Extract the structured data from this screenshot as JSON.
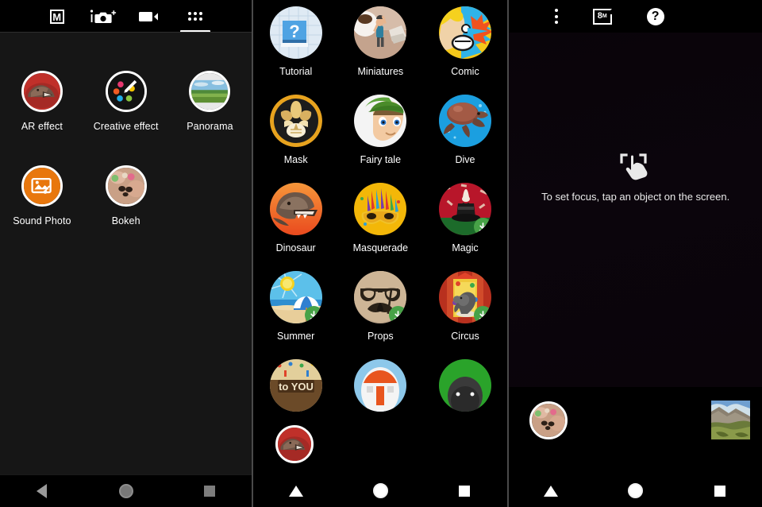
{
  "left_panel": {
    "name": "camera-mode-picker",
    "topbar": {
      "modes": [
        {
          "id": "manual-mode",
          "icon": "m-badge-icon",
          "label": "M",
          "active": false
        },
        {
          "id": "superior-auto-mode",
          "icon": "camera-plus-icon",
          "label": "i+",
          "active": false
        },
        {
          "id": "video-mode",
          "icon": "video-camera-icon",
          "label": "Video",
          "active": false
        },
        {
          "id": "apps-mode",
          "icon": "app-grid-icon",
          "label": "Apps",
          "active": true
        }
      ]
    },
    "effects": [
      {
        "label": "AR effect",
        "icon": "ar-effect-icon",
        "bg": "#b5302a"
      },
      {
        "label": "Creative effect",
        "icon": "creative-effect-icon",
        "bg": "#121212"
      },
      {
        "label": "Panorama",
        "icon": "panorama-icon",
        "bg": "#86b06a"
      },
      {
        "label": "Sound Photo",
        "icon": "sound-photo-icon",
        "bg": "#e8770d"
      },
      {
        "label": "Bokeh",
        "icon": "bokeh-icon",
        "bg": "#c79a84"
      }
    ]
  },
  "middle_panel": {
    "name": "ar-effect-gallery",
    "effects": [
      {
        "label": "Tutorial",
        "icon": "tutorial-book-icon",
        "bg": "#d9e7f2",
        "downloadable": false
      },
      {
        "label": "Miniatures",
        "icon": "miniatures-icon",
        "bg": "#c7a893",
        "downloadable": false
      },
      {
        "label": "Comic",
        "icon": "comic-icon",
        "bg": "#f2c200",
        "downloadable": false
      },
      {
        "label": "Mask",
        "icon": "mask-icon",
        "bg": "#1c1c1c",
        "downloadable": false
      },
      {
        "label": "Fairy tale",
        "icon": "fairy-tale-icon",
        "bg": "#f2f2f2",
        "downloadable": false
      },
      {
        "label": "Dive",
        "icon": "dive-icon",
        "bg": "#1b9fe0",
        "downloadable": false
      },
      {
        "label": "Dinosaur",
        "icon": "dinosaur-icon",
        "bg": "#f2621e",
        "downloadable": false
      },
      {
        "label": "Masquerade",
        "icon": "masquerade-icon",
        "bg": "#f3b708",
        "downloadable": false
      },
      {
        "label": "Magic",
        "icon": "magic-icon",
        "bg": "#c2152a",
        "downloadable": true
      },
      {
        "label": "Summer",
        "icon": "summer-icon",
        "bg": "#57b7e8",
        "downloadable": true
      },
      {
        "label": "Props",
        "icon": "props-icon",
        "bg": "#c3ab8f",
        "downloadable": true
      },
      {
        "label": "Circus",
        "icon": "circus-icon",
        "bg": "#d14b2a",
        "downloadable": true
      },
      {
        "label": "",
        "icon": "birthday-icon",
        "bg": "#e2cf9b",
        "downloadable": false
      },
      {
        "label": "",
        "icon": "cartoon-house-icon",
        "bg": "#8dc8ea",
        "downloadable": false
      },
      {
        "label": "",
        "icon": "green-field-icon",
        "bg": "#2aa32a",
        "downloadable": false
      }
    ],
    "floating_selection": {
      "label": "AR effect",
      "icon": "ar-effect-icon"
    }
  },
  "right_panel": {
    "name": "camera-viewfinder",
    "topbar": [
      {
        "id": "overflow-menu",
        "icon": "three-dots-icon",
        "label": "More"
      },
      {
        "id": "resolution-setting",
        "icon": "resolution-badge-icon",
        "label": "8",
        "sublabel": "M"
      },
      {
        "id": "help-button",
        "icon": "help-question-icon",
        "label": "?"
      }
    ],
    "focus_hint": {
      "icon": "tap-to-focus-icon",
      "text": "To set focus, tap an object on the screen."
    },
    "bottom": {
      "mode_thumb": {
        "icon": "bokeh-icon",
        "label": "Bokeh"
      },
      "photo_thumb": {
        "icon": "gallery-thumbnail-icon",
        "label": "Last photo"
      }
    }
  },
  "navbars": [
    {
      "panel": "left",
      "style": "grey",
      "buttons": [
        {
          "id": "back-button",
          "icon": "back-triangle-icon"
        },
        {
          "id": "home-button",
          "icon": "home-circle-icon"
        },
        {
          "id": "recents-button",
          "icon": "recents-square-icon"
        }
      ]
    },
    {
      "panel": "middle",
      "style": "white",
      "buttons": [
        {
          "id": "back-button",
          "icon": "back-triangle-up-icon"
        },
        {
          "id": "home-button",
          "icon": "home-circle-icon"
        },
        {
          "id": "recents-button",
          "icon": "recents-square-icon"
        }
      ]
    },
    {
      "panel": "right",
      "style": "white",
      "buttons": [
        {
          "id": "back-button",
          "icon": "back-triangle-up-icon"
        },
        {
          "id": "home-button",
          "icon": "home-circle-icon"
        },
        {
          "id": "recents-button",
          "icon": "recents-square-icon"
        }
      ]
    }
  ],
  "colors": {
    "download_badge": "#47a247",
    "panel_bg": "#161616",
    "black": "#000000",
    "text": "#ffffff"
  }
}
